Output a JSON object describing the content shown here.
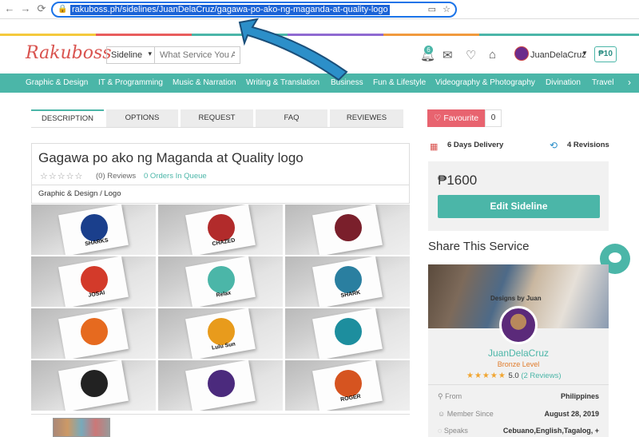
{
  "browser": {
    "url": "rakuboss.ph/sidelines/JuanDelaCruz/gagawa-po-ako-ng-maganda-at-quality-logo",
    "back_icon": "arrow-left-icon",
    "forward_icon": "arrow-right-icon",
    "reload_icon": "reload-icon"
  },
  "header": {
    "logo": "Rakuboss",
    "search_select": "Sideline",
    "search_placeholder": "What Service You Are L",
    "notification_count": "6",
    "username": "JuanDelaCruz",
    "currency_button": "₱10"
  },
  "categories": [
    "Graphic & Design",
    "IT & Programming",
    "Music & Narration",
    "Writing & Translation",
    "Business",
    "Fun & Lifestyle",
    "Videography & Photography",
    "Divination",
    "Travel"
  ],
  "tabs": [
    "DESCRIPTION",
    "OPTIONS",
    "REQUEST",
    "FAQ",
    "REVIEWES"
  ],
  "service": {
    "title": "Gagawa po ako ng Maganda at Quality logo",
    "empty_stars": "☆☆☆☆☆",
    "reviews": "(0) Reviews",
    "orders": "0 Orders In Queue",
    "breadcrumb": "Graphic & Design / Logo"
  },
  "gallery": [
    {
      "label": "SHARKS",
      "color": "#1a3f8c"
    },
    {
      "label": "CHAZED",
      "color": "#b22b2b"
    },
    {
      "label": "",
      "color": "#7a1f2b"
    },
    {
      "label": "JOSAI",
      "color": "#d33a2a"
    },
    {
      "label": "Relax",
      "color": "#4bb6a8"
    },
    {
      "label": "SHARK",
      "color": "#2a7fa0"
    },
    {
      "label": "",
      "color": "#e66a1f"
    },
    {
      "label": "Lulu Sun",
      "color": "#e89b1c"
    },
    {
      "label": "",
      "color": "#1d8e9e"
    },
    {
      "label": "",
      "color": "#222222"
    },
    {
      "label": "",
      "color": "#4b2a7d"
    },
    {
      "label": "ROGER",
      "color": "#d65420"
    }
  ],
  "sidebar": {
    "favourite": "Favourite",
    "favourite_count": "0",
    "delivery": "6 Days Delivery",
    "revisions": "4 Revisions",
    "price": "₱1600",
    "edit_button": "Edit Sideline",
    "share_heading": "Share This Service"
  },
  "profile": {
    "cover_text": "Designs by Juan",
    "name": "JuanDelaCruz",
    "level": "Bronze Level",
    "stars": "★★★★★",
    "score": "5.0",
    "review_count": "(2 Reviews)",
    "from_label": "From",
    "from_value": "Philippines",
    "member_label": "Member Since",
    "member_value": "August 28, 2019",
    "speaks_label": "Speaks",
    "speaks_value": "Cebuano,English,Tagalog, +"
  },
  "colors": {
    "accent": "#4bb6a8",
    "favourite": "#e8636f",
    "arrow": "#2c8fc9"
  }
}
